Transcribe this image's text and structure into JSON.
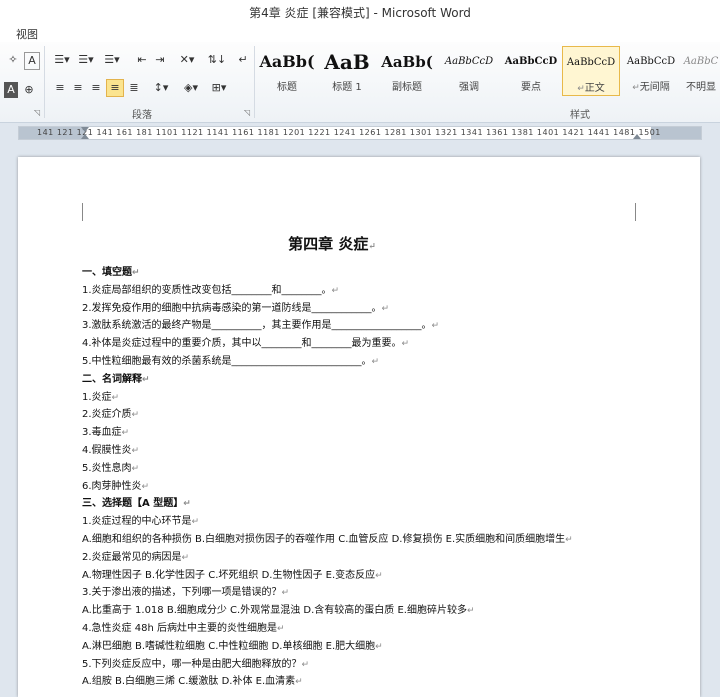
{
  "window": {
    "title": "第4章  炎症 [兼容模式] - Microsoft Word"
  },
  "menu": {
    "tab": "视图"
  },
  "ribbon": {
    "groups": {
      "paragraph": "段落",
      "styles": "样式"
    },
    "styles": [
      {
        "preview": "AaBb(",
        "name": "标题"
      },
      {
        "preview": "AaB",
        "name": "标题 1"
      },
      {
        "preview": "AaBb(",
        "name": "副标题"
      },
      {
        "preview": "AaBbCcD",
        "name": "强调"
      },
      {
        "preview": "AaBbCcD",
        "name": "要点"
      },
      {
        "preview": "AaBbCcD",
        "name": "正文"
      },
      {
        "preview": "AaBbCcD",
        "name": "无间隔"
      },
      {
        "preview": "AaBbC",
        "name": "不明显"
      }
    ],
    "active_style": "正文",
    "highlight_color": "#fbe48f"
  },
  "ruler": {
    "numbers": "141 121  121 141 161 181 1101 1121 1141 1161 1181 1201 1221 1241 1261 1281 1301 1321 1341 1361 1381 1401 1421 1441  1481 1501"
  },
  "document": {
    "title": "第四章    炎症",
    "lines": [
      {
        "text": "一、填空题",
        "bold": true
      },
      {
        "text": "1.炎症局部组织的变质性改变包括________和________。",
        "bold": false
      },
      {
        "text": "2.发挥免疫作用的细胞中抗病毒感染的第一道防线是____________。",
        "bold": false
      },
      {
        "text": "3.激肽系统激活的最终产物是__________，其主要作用是__________________。",
        "bold": false
      },
      {
        "text": "4.补体是炎症过程中的重要介质，其中以________和________最为重要。",
        "bold": false
      },
      {
        "text": "5.中性粒细胞最有效的杀菌系统是__________________________。",
        "bold": false
      },
      {
        "text": "二、名词解释",
        "bold": true
      },
      {
        "text": "1.炎症",
        "bold": false
      },
      {
        "text": "2.炎症介质",
        "bold": false
      },
      {
        "text": "3.毒血症",
        "bold": false
      },
      {
        "text": "4.假膜性炎",
        "bold": false
      },
      {
        "text": "5.炎性息肉",
        "bold": false
      },
      {
        "text": "6.肉芽肿性炎",
        "bold": false
      },
      {
        "text": "三、选择题【A 型题】",
        "bold": true
      },
      {
        "text": "1.炎症过程的中心环节是",
        "bold": false
      },
      {
        "text": "  A.细胞和组织的各种损伤   B.白细胞对损伤因子的吞噬作用   C.血管反应   D.修复损伤   E.实质细胞和间质细胞增生",
        "bold": false
      },
      {
        "text": "2.炎症最常见的病因是",
        "bold": false
      },
      {
        "text": "  A.物理性因子     B.化学性因子     C.坏死组织     D.生物性因子     E.变态反应",
        "bold": false
      },
      {
        "text": "3.关于渗出液的描述，下列哪一项是错误的？",
        "bold": false
      },
      {
        "text": "  A.比重高于 1.018    B.细胞成分少    C.外观常显混浊    D.含有较高的蛋白质    E.细胞碎片较多",
        "bold": false
      },
      {
        "text": "4.急性炎症 48h 后病灶中主要的炎性细胞是",
        "bold": false
      },
      {
        "text": "  A.淋巴细胞     B.嗜碱性粒细胞     C.中性粒细胞     D.单核细胞     E.肥大细胞",
        "bold": false
      },
      {
        "text": "5.下列炎症反应中，哪一种是由肥大细胞释放的？",
        "bold": false
      },
      {
        "text": "  A.组胺     B.白细胞三烯     C.缓激肽     D.补体     E.血清素",
        "bold": false
      }
    ]
  }
}
